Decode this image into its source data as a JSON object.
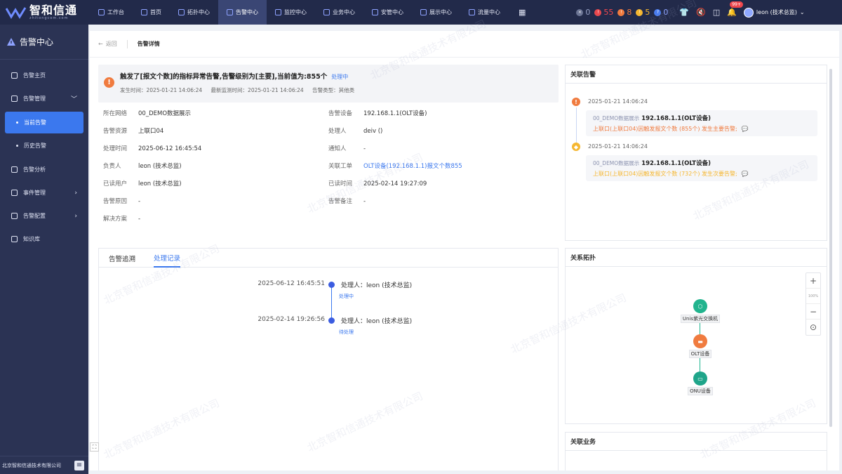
{
  "brand": {
    "title": "智和信通",
    "subtitle": "zhitongcom.com"
  },
  "nav": [
    {
      "label": "工作台",
      "icon": "workbench-icon"
    },
    {
      "label": "首页",
      "icon": "home-icon"
    },
    {
      "label": "拓扑中心",
      "icon": "topology-icon"
    },
    {
      "label": "告警中心",
      "icon": "alarm-icon",
      "active": true
    },
    {
      "label": "监控中心",
      "icon": "monitor-icon"
    },
    {
      "label": "业务中心",
      "icon": "business-icon"
    },
    {
      "label": "安管中心",
      "icon": "security-icon"
    },
    {
      "label": "展示中心",
      "icon": "display-icon"
    },
    {
      "label": "流量中心",
      "icon": "traffic-icon"
    }
  ],
  "status_counts": [
    {
      "value": "0",
      "color": "#6b7494"
    },
    {
      "value": "55",
      "color": "#e8484e"
    },
    {
      "value": "8",
      "color": "#f07b3f"
    },
    {
      "value": "5",
      "color": "#f5b731"
    },
    {
      "value": "0",
      "color": "#4a7df0"
    }
  ],
  "notifications": "99+",
  "user": "leon (技术总监)",
  "sidebar": {
    "title": "告警中心",
    "items": [
      {
        "label": "告警主页",
        "icon": "home-icon"
      },
      {
        "label": "告警管理",
        "icon": "bell-icon",
        "chevron": "﹀"
      },
      {
        "label": "告警分析",
        "icon": "chart-icon"
      },
      {
        "label": "事件管理",
        "icon": "event-icon",
        "chevron": "›"
      },
      {
        "label": "告警配置",
        "icon": "config-icon",
        "chevron": "›"
      },
      {
        "label": "知识库",
        "icon": "book-icon"
      }
    ],
    "sub_items": [
      "当前告警",
      "历史告警"
    ],
    "footer": "北京智和信通技术有限公司"
  },
  "breadcrumb": {
    "back": "返回",
    "current": "告警详情"
  },
  "alert": {
    "title": "触发了[报文个数]的指标异常告警,告警级别为[主要],当前值为:855个",
    "status": "处理中",
    "occur_time": "发生时间：2025-01-21 14:06:24",
    "latest_time": "最新监测时间：2025-01-21 14:06:24",
    "type": "告警类型：其他类"
  },
  "info": {
    "network": {
      "k": "所在网络",
      "v": "00_DEMO数据展示"
    },
    "device": {
      "k": "告警设备",
      "v": "192.168.1.1(OLT设备)"
    },
    "resource": {
      "k": "告警资源",
      "v": "上联口04"
    },
    "handler": {
      "k": "处理人",
      "v": "deiv ()"
    },
    "handle_time": {
      "k": "处理时间",
      "v": "2025-06-12 16:45:54"
    },
    "notifier": {
      "k": "通知人",
      "v": "-"
    },
    "owner": {
      "k": "负责人",
      "v": "leon (技术总监)"
    },
    "ticket": {
      "k": "关联工单",
      "v": "OLT设备(192.168.1.1)报文个数855"
    },
    "reader": {
      "k": "已读用户",
      "v": "leon (技术总监)"
    },
    "read_time": {
      "k": "已读时间",
      "v": "2025-02-14 19:27:09"
    },
    "cause": {
      "k": "告警原因",
      "v": "-"
    },
    "note": {
      "k": "告警备注",
      "v": "-"
    },
    "solution": {
      "k": "解决方案",
      "v": "-"
    }
  },
  "trace": {
    "tabs": [
      "告警追溯",
      "处理记录"
    ],
    "records": [
      {
        "time": "2025-06-12 16:45:51",
        "label": "处理人：leon (技术总监)",
        "status": "处理中"
      },
      {
        "time": "2025-02-14 19:26:56",
        "label": "处理人：leon (技术总监)",
        "status": "待处理"
      }
    ]
  },
  "related_alarms": {
    "title": "关联告警",
    "items": [
      {
        "time": "2025-01-21 14:06:24",
        "tag": "00_DEMO数据展示",
        "device": "192.168.1.1(OLT设备)",
        "desc": "上联口(上联口04)因触发报文个数 (855个) 发生主要告警;",
        "color": "#f07b3f",
        "symbol": "!"
      },
      {
        "time": "2025-01-21 14:06:24",
        "tag": "00_DEMO数据展示",
        "device": "192.168.1.1(OLT设备)",
        "desc": "上联口(上联口04)因触发报文个数 (732个) 发生次要告警;",
        "color": "#f5b731",
        "symbol": "◆"
      }
    ]
  },
  "topology": {
    "title": "关系拓扑",
    "zoom": "100%",
    "nodes": [
      {
        "label": "Unis紫光交换机",
        "color": "#22b48e"
      },
      {
        "label": "OLT设备",
        "color": "#f07b3f"
      },
      {
        "label": "ONU设备",
        "color": "#1fa58a"
      }
    ]
  },
  "related_business": {
    "title": "关联业务"
  },
  "watermark": "北京智和信通技术有限公司"
}
